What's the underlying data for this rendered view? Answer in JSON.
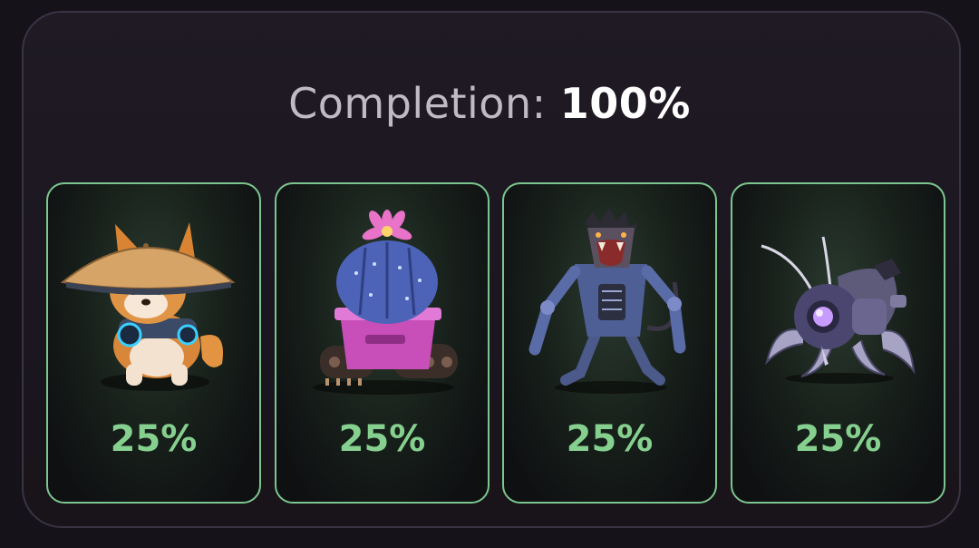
{
  "header": {
    "label": "Completion:",
    "value": "100%"
  },
  "cards": [
    {
      "icon": "shiba-dog-straw-hat-icon",
      "percent": "25%"
    },
    {
      "icon": "cactus-tank-icon",
      "percent": "25%"
    },
    {
      "icon": "robot-werewolf-icon",
      "percent": "25%"
    },
    {
      "icon": "robot-spider-bug-icon",
      "percent": "25%"
    }
  ],
  "colors": {
    "accent_green": "#86d08f",
    "card_border": "#7cc68e",
    "panel_border": "#3a3344",
    "background": "#16121a"
  }
}
